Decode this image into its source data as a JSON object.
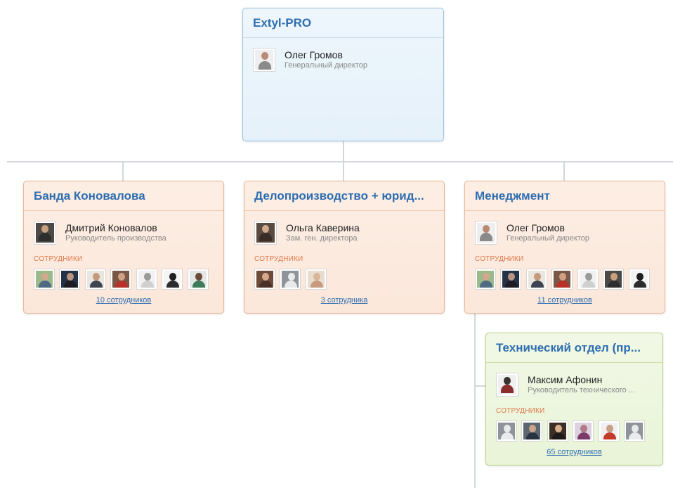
{
  "root": {
    "title": "Extyl-PRO",
    "head": {
      "name": "Олег Громов",
      "role": "Генеральный директор"
    }
  },
  "departments": [
    {
      "title": "Банда Коновалова",
      "head": {
        "name": "Дмитрий Коновалов",
        "role": "Руководитель производства"
      },
      "employees_label": "СОТРУДНИКИ",
      "employees": [
        "photo",
        "photo",
        "photo",
        "photo",
        "photo",
        "photo",
        "photo"
      ],
      "count_link": "10 сотрудников"
    },
    {
      "title": "Делопроизводство + юрид...",
      "head": {
        "name": "Ольга Каверина",
        "role": "Зам. ген. директора"
      },
      "employees_label": "СОТРУДНИКИ",
      "employees": [
        "photo",
        "placeholder",
        "photo"
      ],
      "count_link": "3 сотрудника"
    },
    {
      "title": "Менеджмент",
      "head": {
        "name": "Олег Громов",
        "role": "Генеральный директор"
      },
      "employees_label": "СОТРУДНИКИ",
      "employees": [
        "photo",
        "photo",
        "photo",
        "photo",
        "photo",
        "photo",
        "photo"
      ],
      "count_link": "11 сотрудников"
    }
  ],
  "subdepartment": {
    "title": "Технический отдел (пр...",
    "head": {
      "name": "Максим Афонин",
      "role": "Руководитель технического ..."
    },
    "employees_label": "СОТРУДНИКИ",
    "employees": [
      "placeholder",
      "photo",
      "photo",
      "photo",
      "photo",
      "placeholder"
    ],
    "count_link": "65 сотрудников"
  },
  "colors": {
    "link": "#2d6db0",
    "root_card_bg": "#e5f1fa",
    "dept_card_bg": "#fbe7da",
    "sub_card_bg": "#e9f4d8",
    "section_label": "#de7a4a",
    "connector": "#d3d7db"
  }
}
